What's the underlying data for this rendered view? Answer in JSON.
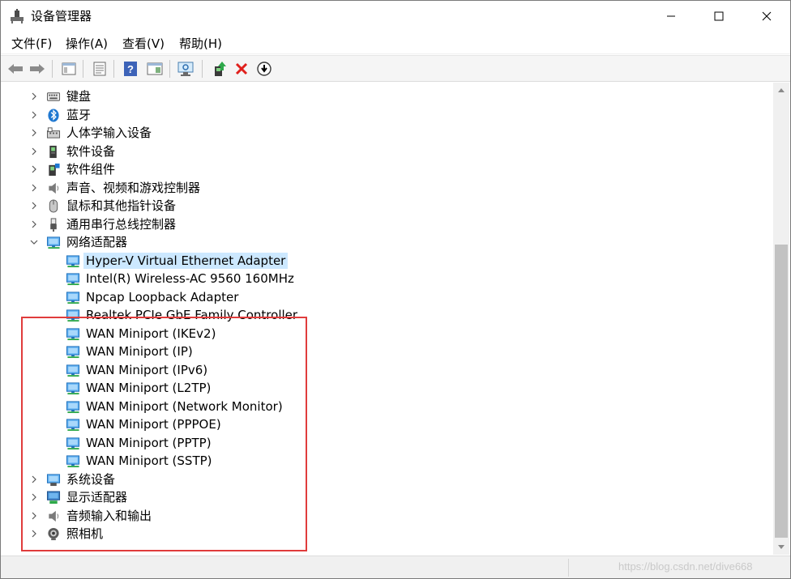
{
  "window": {
    "title": "设备管理器",
    "controls": {
      "minimize_icon": "minimize-icon",
      "maximize_icon": "maximize-icon",
      "close_icon": "close-icon"
    }
  },
  "menubar": {
    "items": [
      {
        "label": "文件(F)"
      },
      {
        "label": "操作(A)"
      },
      {
        "label": "查看(V)"
      },
      {
        "label": "帮助(H)"
      }
    ]
  },
  "toolbar": {
    "buttons": [
      "back-arrow-icon",
      "forward-arrow-icon",
      "show-hide-tree-icon",
      "properties-icon",
      "help-icon",
      "action-pane-icon",
      "scan-hardware-icon",
      "update-driver-icon",
      "uninstall-device-icon",
      "disable-device-icon"
    ]
  },
  "tree": {
    "categories_top": [
      {
        "label": "键盘",
        "icon": "keyboard-icon"
      },
      {
        "label": "蓝牙",
        "icon": "bluetooth-icon"
      },
      {
        "label": "人体学输入设备",
        "icon": "hid-icon"
      },
      {
        "label": "软件设备",
        "icon": "software-device-icon"
      },
      {
        "label": "软件组件",
        "icon": "software-component-icon"
      },
      {
        "label": "声音、视频和游戏控制器",
        "icon": "speaker-icon"
      },
      {
        "label": "鼠标和其他指针设备",
        "icon": "mouse-icon"
      },
      {
        "label": "通用串行总线控制器",
        "icon": "usb-icon"
      }
    ],
    "expanded_category": {
      "label": "网络适配器",
      "icon": "network-adapter-icon"
    },
    "adapters": [
      {
        "label": "Hyper-V Virtual Ethernet Adapter",
        "selected": true
      },
      {
        "label": "Intel(R) Wireless-AC 9560 160MHz"
      },
      {
        "label": "Npcap Loopback Adapter"
      },
      {
        "label": "Realtek PCIe GbE Family Controller"
      },
      {
        "label": "WAN Miniport (IKEv2)"
      },
      {
        "label": "WAN Miniport (IP)"
      },
      {
        "label": "WAN Miniport (IPv6)"
      },
      {
        "label": "WAN Miniport (L2TP)"
      },
      {
        "label": "WAN Miniport (Network Monitor)"
      },
      {
        "label": "WAN Miniport (PPPOE)"
      },
      {
        "label": "WAN Miniport (PPTP)"
      },
      {
        "label": "WAN Miniport (SSTP)"
      }
    ],
    "categories_bottom": [
      {
        "label": "系统设备",
        "icon": "system-device-icon"
      },
      {
        "label": "显示适配器",
        "icon": "display-adapter-icon"
      },
      {
        "label": "音频输入和输出",
        "icon": "audio-io-icon"
      },
      {
        "label": "照相机",
        "icon": "camera-icon"
      }
    ]
  },
  "statusbar": {
    "watermark": "https://blog.csdn.net/dive668"
  },
  "colors": {
    "selection": "#cce8ff",
    "highlight_box": "#e03c3c",
    "network_icon": "#2e86d6"
  }
}
